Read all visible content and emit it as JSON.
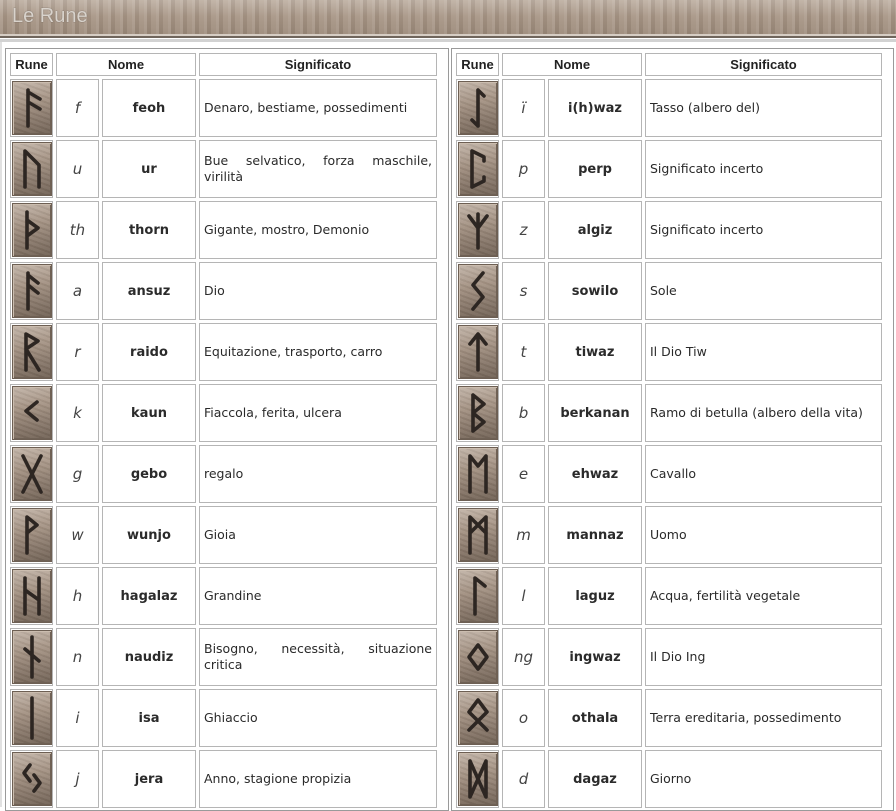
{
  "title": "Le Rune",
  "headers": {
    "rune": "Rune",
    "name": "Nome",
    "meaning": "Significato"
  },
  "left": [
    {
      "icon": "fehu-rune-icon",
      "letter": "f",
      "name": "feoh",
      "meaning": "Denaro, bestiame, possedimenti"
    },
    {
      "icon": "uruz-rune-icon",
      "letter": "u",
      "name": "ur",
      "meaning": "Bue selvatico, forza maschile, virilità"
    },
    {
      "icon": "thurisaz-rune-icon",
      "letter": "th",
      "name": "thorn",
      "meaning": "Gigante, mostro, Demonio"
    },
    {
      "icon": "ansuz-rune-icon",
      "letter": "a",
      "name": "ansuz",
      "meaning": "Dio"
    },
    {
      "icon": "raido-rune-icon",
      "letter": "r",
      "name": "raido",
      "meaning": "Equitazione, trasporto, carro"
    },
    {
      "icon": "kaun-rune-icon",
      "letter": "k",
      "name": "kaun",
      "meaning": "Fiaccola, ferita, ulcera"
    },
    {
      "icon": "gebo-rune-icon",
      "letter": "g",
      "name": "gebo",
      "meaning": "regalo"
    },
    {
      "icon": "wunjo-rune-icon",
      "letter": "w",
      "name": "wunjo",
      "meaning": "Gioia"
    },
    {
      "icon": "hagalaz-rune-icon",
      "letter": "h",
      "name": "hagalaz",
      "meaning": "Grandine"
    },
    {
      "icon": "naudiz-rune-icon",
      "letter": "n",
      "name": "naudiz",
      "meaning": "Bisogno, necessità, situazione critica"
    },
    {
      "icon": "isa-rune-icon",
      "letter": "i",
      "name": "isa",
      "meaning": "Ghiaccio"
    },
    {
      "icon": "jera-rune-icon",
      "letter": "j",
      "name": "jera",
      "meaning": "Anno, stagione propizia"
    }
  ],
  "right": [
    {
      "icon": "ihwaz-rune-icon",
      "letter": "ï",
      "name": "i(h)waz",
      "meaning": "Tasso (albero del)"
    },
    {
      "icon": "perp-rune-icon",
      "letter": "p",
      "name": "perp",
      "meaning": "Significato incerto"
    },
    {
      "icon": "algiz-rune-icon",
      "letter": "z",
      "name": "algiz",
      "meaning": "Significato incerto"
    },
    {
      "icon": "sowilo-rune-icon",
      "letter": "s",
      "name": "sowilo",
      "meaning": "Sole"
    },
    {
      "icon": "tiwaz-rune-icon",
      "letter": "t",
      "name": "tiwaz",
      "meaning": "Il Dio Tiw"
    },
    {
      "icon": "berkanan-rune-icon",
      "letter": "b",
      "name": "berkanan",
      "meaning": "Ramo di betulla (albero della vita)"
    },
    {
      "icon": "ehwaz-rune-icon",
      "letter": "e",
      "name": "ehwaz",
      "meaning": "Cavallo"
    },
    {
      "icon": "mannaz-rune-icon",
      "letter": "m",
      "name": "mannaz",
      "meaning": "Uomo"
    },
    {
      "icon": "laguz-rune-icon",
      "letter": "l",
      "name": "laguz",
      "meaning": "Acqua, fertilità vegetale"
    },
    {
      "icon": "ingwaz-rune-icon",
      "letter": "ng",
      "name": "ingwaz",
      "meaning": "Il Dio Ing"
    },
    {
      "icon": "othala-rune-icon",
      "letter": "o",
      "name": "othala",
      "meaning": "Terra ereditaria, possedimento"
    },
    {
      "icon": "dagaz-rune-icon",
      "letter": "d",
      "name": "dagaz",
      "meaning": "Giorno"
    }
  ]
}
